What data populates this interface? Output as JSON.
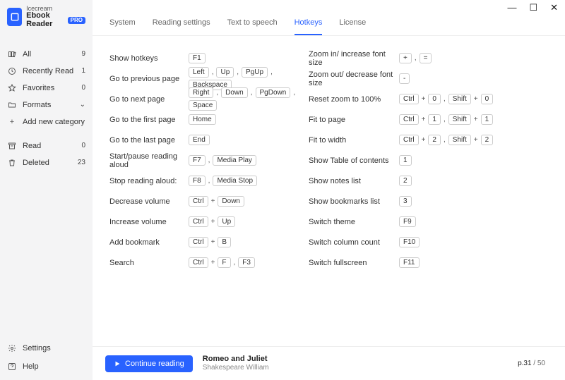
{
  "brand": {
    "line1": "Icecream",
    "line2": "Ebook Reader",
    "badge": "PRO"
  },
  "sidebar": {
    "items": [
      {
        "label": "All",
        "count": "9"
      },
      {
        "label": "Recently Read",
        "count": "1"
      },
      {
        "label": "Favorites",
        "count": "0"
      },
      {
        "label": "Formats",
        "count": ""
      },
      {
        "label": "Add new category",
        "count": ""
      },
      {
        "label": "Read",
        "count": "0"
      },
      {
        "label": "Deleted",
        "count": "23"
      }
    ],
    "bottom": [
      {
        "label": "Settings"
      },
      {
        "label": "Help"
      }
    ]
  },
  "tabs": [
    "System",
    "Reading settings",
    "Text to speech",
    "Hotkeys",
    "License"
  ],
  "active_tab": 3,
  "hotkeys_left": [
    {
      "label": "Show hotkeys",
      "keys": [
        [
          "F1"
        ]
      ]
    },
    {
      "label": "Go to previous page",
      "keys": [
        [
          "Left"
        ],
        [
          "Up"
        ],
        [
          "PgUp"
        ],
        [
          "Backspace"
        ]
      ]
    },
    {
      "label": "Go to next page",
      "keys": [
        [
          "Right"
        ],
        [
          "Down"
        ],
        [
          "PgDown"
        ],
        [
          "Space"
        ]
      ]
    },
    {
      "label": "Go to the first page",
      "keys": [
        [
          "Home"
        ]
      ]
    },
    {
      "label": "Go to the last page",
      "keys": [
        [
          "End"
        ]
      ]
    },
    {
      "label": "Start/pause reading aloud",
      "keys": [
        [
          "F7"
        ],
        [
          "Media Play"
        ]
      ]
    },
    {
      "label": "Stop reading aloud:",
      "keys": [
        [
          "F8"
        ],
        [
          "Media Stop"
        ]
      ]
    },
    {
      "label": "Decrease volume",
      "keys": [
        [
          "Ctrl",
          "Down"
        ]
      ]
    },
    {
      "label": "Increase volume",
      "keys": [
        [
          "Ctrl",
          "Up"
        ]
      ]
    },
    {
      "label": "Add bookmark",
      "keys": [
        [
          "Ctrl",
          "B"
        ]
      ]
    },
    {
      "label": "Search",
      "keys": [
        [
          "Ctrl",
          "F"
        ],
        [
          "F3"
        ]
      ]
    }
  ],
  "hotkeys_right": [
    {
      "label": "Zoom in/ increase font size",
      "keys": [
        [
          "+"
        ],
        [
          "="
        ]
      ]
    },
    {
      "label": "Zoom out/ decrease font size",
      "keys": [
        [
          "-"
        ]
      ]
    },
    {
      "label": "Reset zoom to 100%",
      "keys": [
        [
          "Ctrl",
          "0"
        ],
        [
          "Shift",
          "0"
        ]
      ]
    },
    {
      "label": "Fit to page",
      "keys": [
        [
          "Ctrl",
          "1"
        ],
        [
          "Shift",
          "1"
        ]
      ]
    },
    {
      "label": "Fit to width",
      "keys": [
        [
          "Ctrl",
          "2"
        ],
        [
          "Shift",
          "2"
        ]
      ]
    },
    {
      "label": "Show Table of contents",
      "keys": [
        [
          "1"
        ]
      ]
    },
    {
      "label": "Show notes list",
      "keys": [
        [
          "2"
        ]
      ]
    },
    {
      "label": "Show bookmarks list",
      "keys": [
        [
          "3"
        ]
      ]
    },
    {
      "label": "Switch theme",
      "keys": [
        [
          "F9"
        ]
      ]
    },
    {
      "label": "Switch column count",
      "keys": [
        [
          "F10"
        ]
      ]
    },
    {
      "label": "Switch fullscreen",
      "keys": [
        [
          "F11"
        ]
      ]
    }
  ],
  "footer": {
    "continue": "Continue reading",
    "title": "Romeo and Juliet",
    "author": "Shakespeare William",
    "page_current": "p.31",
    "page_total": " / 50"
  },
  "winbtn": {
    "min": "—",
    "max": "☐",
    "close": "✕"
  }
}
